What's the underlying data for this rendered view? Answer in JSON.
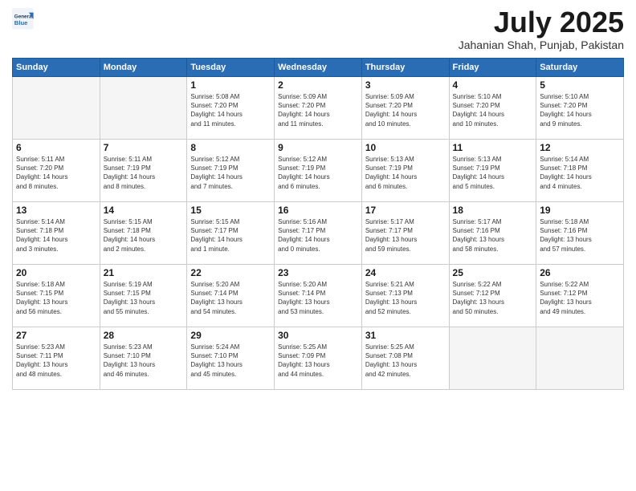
{
  "logo": {
    "line1": "General",
    "line2": "Blue"
  },
  "title": "July 2025",
  "subtitle": "Jahanian Shah, Punjab, Pakistan",
  "header_days": [
    "Sunday",
    "Monday",
    "Tuesday",
    "Wednesday",
    "Thursday",
    "Friday",
    "Saturday"
  ],
  "weeks": [
    [
      {
        "day": "",
        "info": ""
      },
      {
        "day": "",
        "info": ""
      },
      {
        "day": "1",
        "info": "Sunrise: 5:08 AM\nSunset: 7:20 PM\nDaylight: 14 hours\nand 11 minutes."
      },
      {
        "day": "2",
        "info": "Sunrise: 5:09 AM\nSunset: 7:20 PM\nDaylight: 14 hours\nand 11 minutes."
      },
      {
        "day": "3",
        "info": "Sunrise: 5:09 AM\nSunset: 7:20 PM\nDaylight: 14 hours\nand 10 minutes."
      },
      {
        "day": "4",
        "info": "Sunrise: 5:10 AM\nSunset: 7:20 PM\nDaylight: 14 hours\nand 10 minutes."
      },
      {
        "day": "5",
        "info": "Sunrise: 5:10 AM\nSunset: 7:20 PM\nDaylight: 14 hours\nand 9 minutes."
      }
    ],
    [
      {
        "day": "6",
        "info": "Sunrise: 5:11 AM\nSunset: 7:20 PM\nDaylight: 14 hours\nand 8 minutes."
      },
      {
        "day": "7",
        "info": "Sunrise: 5:11 AM\nSunset: 7:19 PM\nDaylight: 14 hours\nand 8 minutes."
      },
      {
        "day": "8",
        "info": "Sunrise: 5:12 AM\nSunset: 7:19 PM\nDaylight: 14 hours\nand 7 minutes."
      },
      {
        "day": "9",
        "info": "Sunrise: 5:12 AM\nSunset: 7:19 PM\nDaylight: 14 hours\nand 6 minutes."
      },
      {
        "day": "10",
        "info": "Sunrise: 5:13 AM\nSunset: 7:19 PM\nDaylight: 14 hours\nand 6 minutes."
      },
      {
        "day": "11",
        "info": "Sunrise: 5:13 AM\nSunset: 7:19 PM\nDaylight: 14 hours\nand 5 minutes."
      },
      {
        "day": "12",
        "info": "Sunrise: 5:14 AM\nSunset: 7:18 PM\nDaylight: 14 hours\nand 4 minutes."
      }
    ],
    [
      {
        "day": "13",
        "info": "Sunrise: 5:14 AM\nSunset: 7:18 PM\nDaylight: 14 hours\nand 3 minutes."
      },
      {
        "day": "14",
        "info": "Sunrise: 5:15 AM\nSunset: 7:18 PM\nDaylight: 14 hours\nand 2 minutes."
      },
      {
        "day": "15",
        "info": "Sunrise: 5:15 AM\nSunset: 7:17 PM\nDaylight: 14 hours\nand 1 minute."
      },
      {
        "day": "16",
        "info": "Sunrise: 5:16 AM\nSunset: 7:17 PM\nDaylight: 14 hours\nand 0 minutes."
      },
      {
        "day": "17",
        "info": "Sunrise: 5:17 AM\nSunset: 7:17 PM\nDaylight: 13 hours\nand 59 minutes."
      },
      {
        "day": "18",
        "info": "Sunrise: 5:17 AM\nSunset: 7:16 PM\nDaylight: 13 hours\nand 58 minutes."
      },
      {
        "day": "19",
        "info": "Sunrise: 5:18 AM\nSunset: 7:16 PM\nDaylight: 13 hours\nand 57 minutes."
      }
    ],
    [
      {
        "day": "20",
        "info": "Sunrise: 5:18 AM\nSunset: 7:15 PM\nDaylight: 13 hours\nand 56 minutes."
      },
      {
        "day": "21",
        "info": "Sunrise: 5:19 AM\nSunset: 7:15 PM\nDaylight: 13 hours\nand 55 minutes."
      },
      {
        "day": "22",
        "info": "Sunrise: 5:20 AM\nSunset: 7:14 PM\nDaylight: 13 hours\nand 54 minutes."
      },
      {
        "day": "23",
        "info": "Sunrise: 5:20 AM\nSunset: 7:14 PM\nDaylight: 13 hours\nand 53 minutes."
      },
      {
        "day": "24",
        "info": "Sunrise: 5:21 AM\nSunset: 7:13 PM\nDaylight: 13 hours\nand 52 minutes."
      },
      {
        "day": "25",
        "info": "Sunrise: 5:22 AM\nSunset: 7:12 PM\nDaylight: 13 hours\nand 50 minutes."
      },
      {
        "day": "26",
        "info": "Sunrise: 5:22 AM\nSunset: 7:12 PM\nDaylight: 13 hours\nand 49 minutes."
      }
    ],
    [
      {
        "day": "27",
        "info": "Sunrise: 5:23 AM\nSunset: 7:11 PM\nDaylight: 13 hours\nand 48 minutes."
      },
      {
        "day": "28",
        "info": "Sunrise: 5:23 AM\nSunset: 7:10 PM\nDaylight: 13 hours\nand 46 minutes."
      },
      {
        "day": "29",
        "info": "Sunrise: 5:24 AM\nSunset: 7:10 PM\nDaylight: 13 hours\nand 45 minutes."
      },
      {
        "day": "30",
        "info": "Sunrise: 5:25 AM\nSunset: 7:09 PM\nDaylight: 13 hours\nand 44 minutes."
      },
      {
        "day": "31",
        "info": "Sunrise: 5:25 AM\nSunset: 7:08 PM\nDaylight: 13 hours\nand 42 minutes."
      },
      {
        "day": "",
        "info": ""
      },
      {
        "day": "",
        "info": ""
      }
    ]
  ]
}
